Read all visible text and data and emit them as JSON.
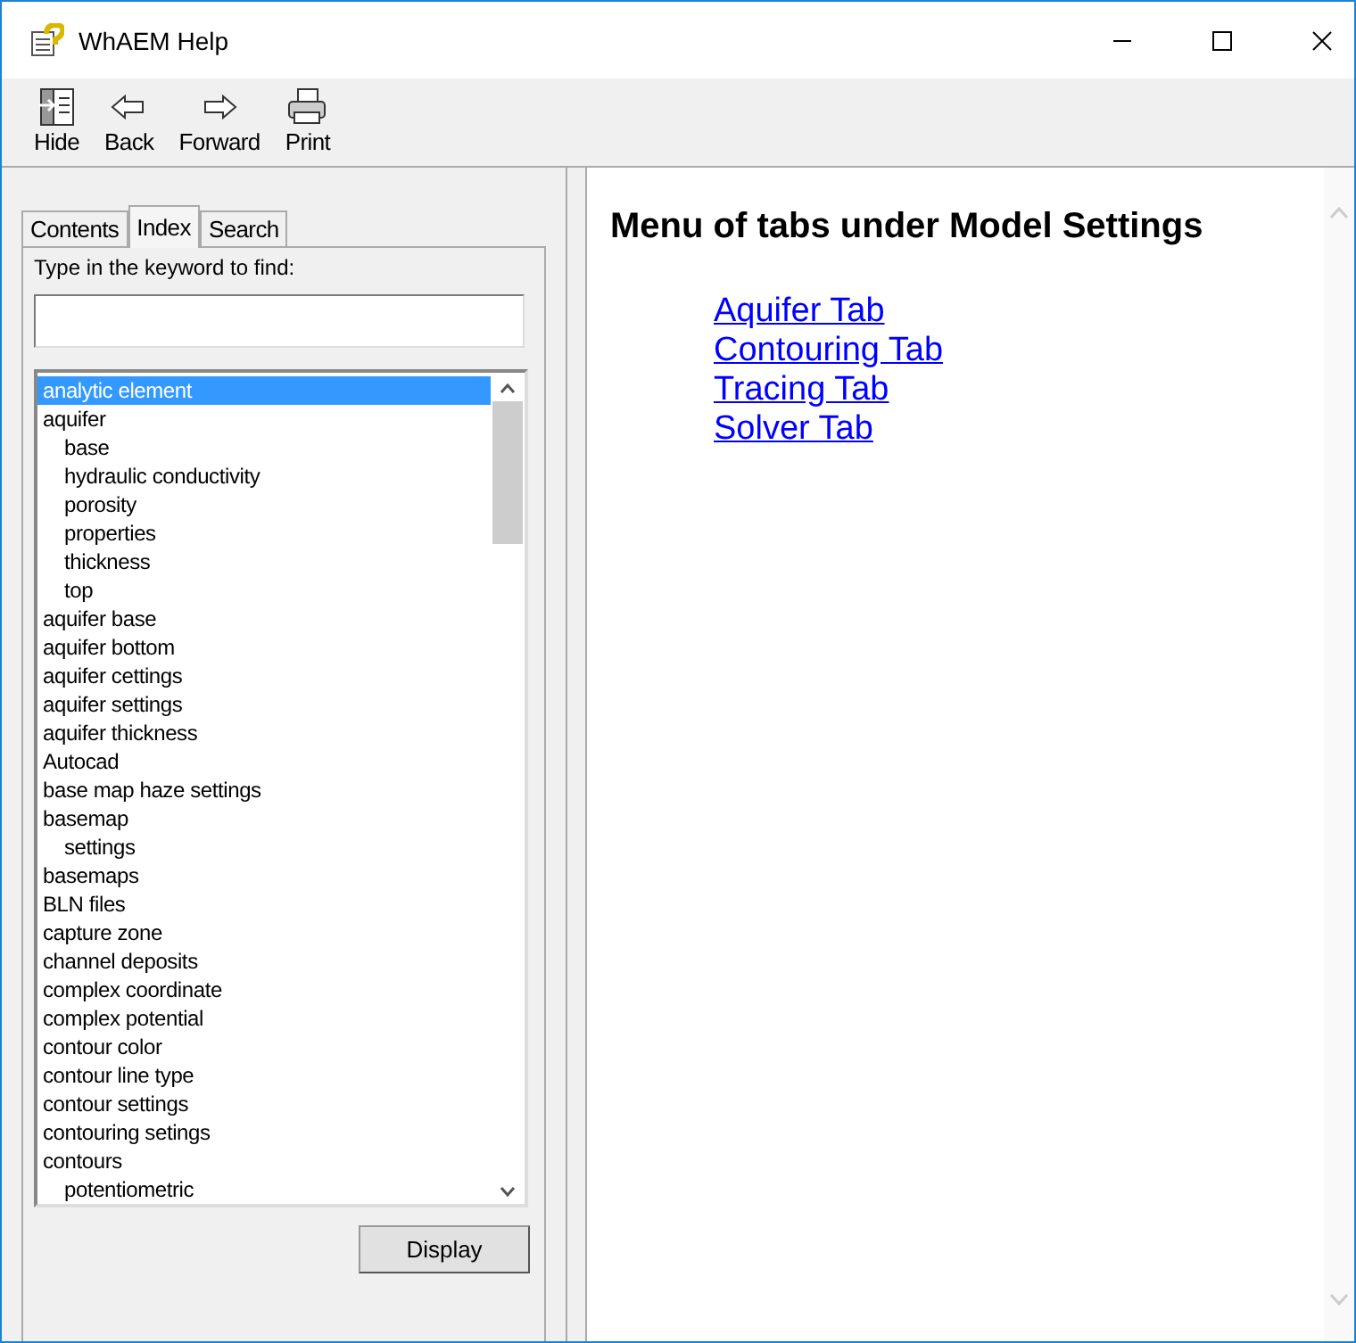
{
  "window": {
    "title": "WhAEM Help"
  },
  "toolbar": [
    {
      "label": "Hide",
      "kind": "hide"
    },
    {
      "label": "Back",
      "kind": "back"
    },
    {
      "label": "Forward",
      "kind": "forward"
    },
    {
      "label": "Print",
      "kind": "print"
    }
  ],
  "tabs": [
    {
      "label": "Contents",
      "selected": false
    },
    {
      "label": "Index",
      "selected": true
    },
    {
      "label": "Search",
      "selected": false
    }
  ],
  "keyword": {
    "label": "Type in the keyword to find:"
  },
  "index": [
    {
      "text": "analytic element",
      "selected": true
    },
    {
      "text": "aquifer",
      "selected": false,
      "children": [
        {
          "text": "base",
          "selected": false
        },
        {
          "text": "hydraulic conductivity",
          "selected": false
        },
        {
          "text": "porosity",
          "selected": false
        },
        {
          "text": "properties",
          "selected": false
        },
        {
          "text": "thickness",
          "selected": false
        },
        {
          "text": "top",
          "selected": false
        }
      ]
    },
    {
      "text": "aquifer base",
      "selected": false
    },
    {
      "text": "aquifer bottom",
      "selected": false
    },
    {
      "text": "aquifer cettings",
      "selected": false
    },
    {
      "text": "aquifer settings",
      "selected": false
    },
    {
      "text": "aquifer thickness",
      "selected": false
    },
    {
      "text": "Autocad",
      "selected": false
    },
    {
      "text": "base map haze settings",
      "selected": false
    },
    {
      "text": "basemap",
      "selected": false,
      "children": [
        {
          "text": "settings",
          "selected": false
        }
      ]
    },
    {
      "text": "basemaps",
      "selected": false
    },
    {
      "text": "BLN files",
      "selected": false
    },
    {
      "text": "capture zone",
      "selected": false
    },
    {
      "text": "channel deposits",
      "selected": false
    },
    {
      "text": "complex coordinate",
      "selected": false
    },
    {
      "text": "complex potential",
      "selected": false
    },
    {
      "text": "contour color",
      "selected": false
    },
    {
      "text": "contour line type",
      "selected": false
    },
    {
      "text": "contour settings",
      "selected": false
    },
    {
      "text": "contouring setings",
      "selected": false
    },
    {
      "text": "contours",
      "selected": false,
      "children": [
        {
          "text": "potentiometric",
          "selected": false
        }
      ]
    }
  ],
  "display_button": "Display",
  "content": {
    "heading": "Menu of tabs under Model Settings",
    "links": [
      "Aquifer Tab",
      "Contouring Tab",
      "Tracing Tab",
      "Solver Tab"
    ]
  }
}
